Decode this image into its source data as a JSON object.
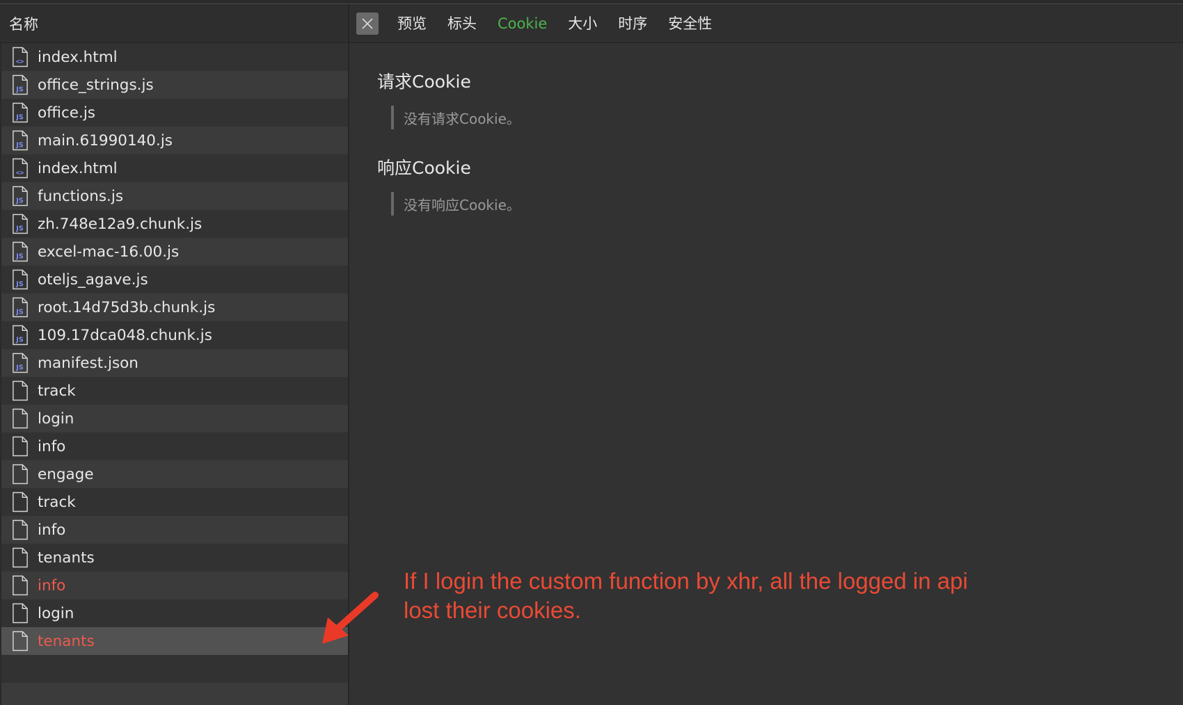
{
  "left_pane": {
    "header": "名称",
    "files": [
      {
        "name": "index.html",
        "icon": "html-file-icon"
      },
      {
        "name": "office_strings.js",
        "icon": "js-file-icon"
      },
      {
        "name": "office.js",
        "icon": "js-file-icon"
      },
      {
        "name": "main.61990140.js",
        "icon": "js-file-icon"
      },
      {
        "name": "index.html",
        "icon": "html-file-icon"
      },
      {
        "name": "functions.js",
        "icon": "js-file-icon"
      },
      {
        "name": "zh.748e12a9.chunk.js",
        "icon": "js-file-icon"
      },
      {
        "name": "excel-mac-16.00.js",
        "icon": "js-file-icon"
      },
      {
        "name": "oteljs_agave.js",
        "icon": "js-file-icon"
      },
      {
        "name": "root.14d75d3b.chunk.js",
        "icon": "js-file-icon"
      },
      {
        "name": "109.17dca048.chunk.js",
        "icon": "js-file-icon"
      },
      {
        "name": "manifest.json",
        "icon": "js-file-icon"
      },
      {
        "name": "track",
        "icon": "generic-file-icon"
      },
      {
        "name": "login",
        "icon": "generic-file-icon"
      },
      {
        "name": "info",
        "icon": "generic-file-icon"
      },
      {
        "name": "engage",
        "icon": "generic-file-icon"
      },
      {
        "name": "track",
        "icon": "generic-file-icon"
      },
      {
        "name": "info",
        "icon": "generic-file-icon"
      },
      {
        "name": "tenants",
        "icon": "generic-file-icon"
      },
      {
        "name": "info",
        "icon": "generic-file-icon",
        "status": "error"
      },
      {
        "name": "login",
        "icon": "generic-file-icon"
      },
      {
        "name": "tenants",
        "icon": "generic-file-icon",
        "status": "error",
        "selected": true
      }
    ]
  },
  "tabs": {
    "items": [
      "预览",
      "标头",
      "Cookie",
      "大小",
      "时序",
      "安全性"
    ],
    "active": "Cookie"
  },
  "cookies": {
    "request_title": "请求Cookie",
    "request_empty": "没有请求Cookie。",
    "response_title": "响应Cookie",
    "response_empty": "没有响应Cookie。"
  },
  "annotation": {
    "text_line1": "If I login the custom function by xhr, all the logged in api",
    "text_line2": "lost their cookies."
  },
  "colors": {
    "active_tab": "#4db34d",
    "error_text": "#ef5a4d",
    "annotation": "#ea4a35",
    "js_badge": "#7b8cf0"
  }
}
